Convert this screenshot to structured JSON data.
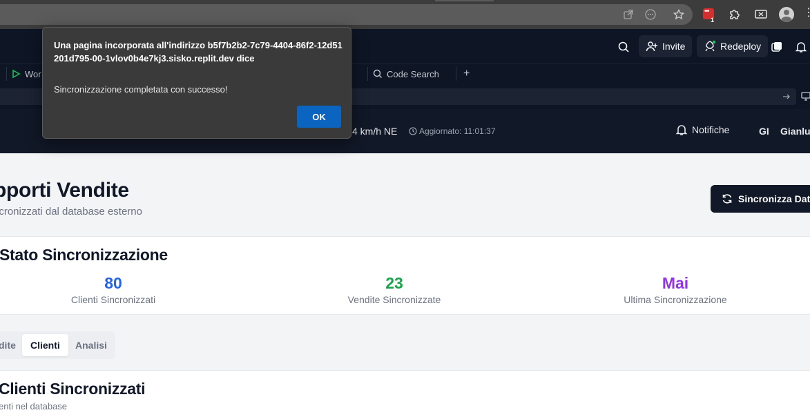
{
  "browser": {
    "extension_badge": "1"
  },
  "replit_header": {
    "invite_label": "Invite",
    "redeploy_label": "Redeploy"
  },
  "workspace_tabs": {
    "tab_workflows_label": "Wor",
    "tab_code_search_label": "Code Search",
    "new_tab_label": "+"
  },
  "app_bar": {
    "weather_text": "4 km/h NE",
    "updated_text": "Aggiornato: 11:01:37",
    "notifications_label": "Notifiche",
    "user_initials": "GI",
    "user_name": "Gianlui"
  },
  "page": {
    "title": "pporti Vendite",
    "subtitle": "ncronizzati dal database esterno",
    "sync_button_label": "Sincronizza Dati"
  },
  "sync_status": {
    "title": "Stato Sincronizzazione",
    "stats": [
      {
        "value": "80",
        "label": "Clienti Sincronizzati",
        "color": "#2563eb"
      },
      {
        "value": "23",
        "label": "Vendite Sincronizzate",
        "color": "#16a34a"
      },
      {
        "value": "Mai",
        "label": "Ultima Sincronizzazione",
        "color": "#9333ea"
      }
    ]
  },
  "tabs": {
    "items": [
      {
        "label": "dite"
      },
      {
        "label": "Clienti"
      },
      {
        "label": "Analisi"
      }
    ],
    "active_index": 1
  },
  "clients_section": {
    "title": "Clienti Sincronizzati",
    "subtitle": "enti nel database"
  },
  "dialog": {
    "title": "Una pagina incorporata all'indirizzo b5f7b2b2-7c79-4404-86f2-12d51201d795-00-1vlov0b4e7kj3.sisko.replit.dev dice",
    "message": "Sincronizzazione completata con successo!",
    "ok_label": "OK"
  }
}
